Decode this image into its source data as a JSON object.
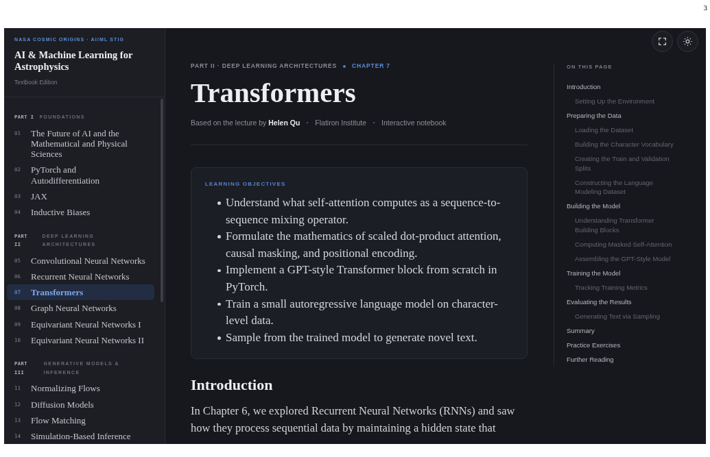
{
  "page_number": "3",
  "sidebar": {
    "kicker": "NASA COSMIC ORIGINS · AI/ML STIG",
    "title": "AI & Machine Learning for Astrophysics",
    "subtitle": "Textbook Edition",
    "parts": [
      {
        "label": "PART I",
        "name": "FOUNDATIONS",
        "chapters": [
          {
            "number": "01",
            "title": "The Future of AI and the Mathematical and Physical Sciences",
            "selected": false
          },
          {
            "number": "02",
            "title": "PyTorch and Autodifferentiation",
            "selected": false
          },
          {
            "number": "03",
            "title": "JAX",
            "selected": false
          },
          {
            "number": "04",
            "title": "Inductive Biases",
            "selected": false
          }
        ]
      },
      {
        "label": "PART II",
        "name": "DEEP LEARNING ARCHITECTURES",
        "chapters": [
          {
            "number": "05",
            "title": "Convolutional Neural Networks",
            "selected": false
          },
          {
            "number": "06",
            "title": "Recurrent Neural Networks",
            "selected": false
          },
          {
            "number": "07",
            "title": "Transformers",
            "selected": true
          },
          {
            "number": "08",
            "title": "Graph Neural Networks",
            "selected": false
          },
          {
            "number": "09",
            "title": "Equivariant Neural Networks I",
            "selected": false
          },
          {
            "number": "10",
            "title": "Equivariant Neural Networks II",
            "selected": false
          }
        ]
      },
      {
        "label": "PART III",
        "name": "GENERATIVE MODELS & INFERENCE",
        "chapters": [
          {
            "number": "11",
            "title": "Normalizing Flows",
            "selected": false
          },
          {
            "number": "12",
            "title": "Diffusion Models",
            "selected": false
          },
          {
            "number": "13",
            "title": "Flow Matching",
            "selected": false
          },
          {
            "number": "14",
            "title": "Simulation-Based Inference",
            "selected": false
          }
        ]
      }
    ]
  },
  "header": {
    "breadcrumb": "PART II · DEEP LEARNING ARCHITECTURES",
    "chapter": "CHAPTER 7",
    "title": "Transformers",
    "meta": [
      "Based on the lecture by **Helen Qu**",
      "Flatiron Institute",
      "Interactive notebook"
    ]
  },
  "objectives": {
    "title": "LEARNING OBJECTIVES",
    "items": [
      "Understand what self-attention computes as a sequence-to-sequence mixing operator.",
      "Formulate the mathematics of scaled dot-product attention, causal masking, and positional encoding.",
      "Implement a GPT-style Transformer block from scratch in PyTorch.",
      "Train a small autoregressive language model on character-level data.",
      "Sample from the trained model to generate novel text."
    ]
  },
  "sections": [
    {
      "heading": "Introduction",
      "paragraphs": [
        "In Chapter 6, we explored Recurrent Neural Networks (RNNs) and saw how they process sequential data by maintaining a hidden state that"
      ]
    }
  ],
  "toc": {
    "title": "ON THIS PAGE",
    "items": [
      {
        "label": "Introduction",
        "children": [
          {
            "label": "Setting Up the Environment"
          }
        ]
      },
      {
        "label": "Preparing the Data",
        "children": [
          {
            "label": "Loading the Dataset"
          },
          {
            "label": "Building the Character Vocabulary"
          },
          {
            "label": "Creating the Train and Validation Splits"
          },
          {
            "label": "Constructing the Language Modeling Dataset"
          }
        ]
      },
      {
        "label": "Building the Model",
        "children": [
          {
            "label": "Understanding Transformer Building Blocks"
          },
          {
            "label": "Computing Masked Self-Attention"
          },
          {
            "label": "Assembling the GPT-Style Model"
          }
        ]
      },
      {
        "label": "Training the Model",
        "children": [
          {
            "label": "Tracking Training Metrics"
          }
        ]
      },
      {
        "label": "Evaluating the Results",
        "children": [
          {
            "label": "Generating Text via Sampling"
          }
        ]
      },
      {
        "label": "Summary"
      },
      {
        "label": "Practice Exercises"
      },
      {
        "label": "Further Reading"
      }
    ]
  }
}
